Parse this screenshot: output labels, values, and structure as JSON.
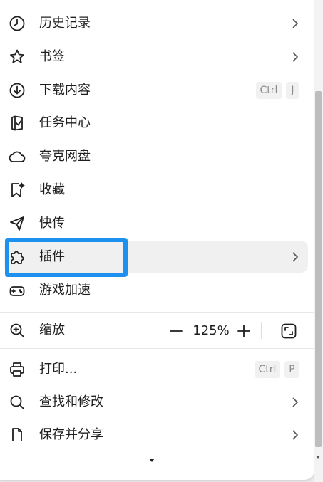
{
  "menu": {
    "items": [
      {
        "label": "历史记录",
        "icon": "clock-icon"
      },
      {
        "label": "书签",
        "icon": "star-icon"
      },
      {
        "label": "下载内容",
        "icon": "download-icon",
        "shortcut": [
          "Ctrl",
          "J"
        ]
      },
      {
        "label": "任务中心",
        "icon": "task-icon"
      },
      {
        "label": "夸克网盘",
        "icon": "cloud-icon"
      },
      {
        "label": "收藏",
        "icon": "bookmark-sparkle-icon"
      },
      {
        "label": "快传",
        "icon": "paper-plane-icon"
      },
      {
        "label": "插件",
        "icon": "puzzle-icon"
      },
      {
        "label": "游戏加速",
        "icon": "gamepad-icon"
      }
    ],
    "zoom": {
      "label": "缩放",
      "icon": "zoom-icon",
      "value": "125%",
      "minus": "—",
      "plus": "+"
    },
    "items2": [
      {
        "label": "打印...",
        "icon": "printer-icon",
        "shortcut": [
          "Ctrl",
          "P"
        ]
      },
      {
        "label": "查找和修改",
        "icon": "search-icon"
      },
      {
        "label": "保存并分享",
        "icon": "share-file-icon"
      }
    ]
  },
  "colors": {
    "highlight": "#1e90ef",
    "text": "#1f1f1f",
    "muted": "#8a8a8a"
  }
}
